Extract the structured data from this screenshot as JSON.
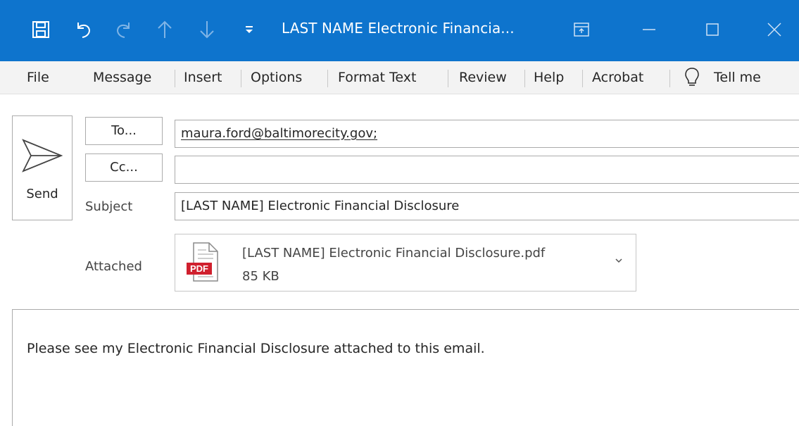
{
  "window": {
    "title": "LAST NAME Electronic Financia...",
    "icons": {
      "save": "save-icon",
      "undo": "undo-icon",
      "redo": "redo-icon",
      "up": "arrow-up-icon",
      "down": "arrow-down-icon",
      "customize": "customize-toolbar-icon",
      "ribbon_display": "ribbon-display-icon",
      "minimize": "minimize-icon",
      "maximize": "maximize-icon",
      "close": "close-icon"
    },
    "colors": {
      "titlebar": "#0e74cd",
      "menubar": "#f3f3f3"
    }
  },
  "menu": {
    "items": [
      "File",
      "Message",
      "Insert",
      "Options",
      "Format Text",
      "Review",
      "Help",
      "Acrobat"
    ],
    "tell_me": "Tell me"
  },
  "compose": {
    "send_label": "Send",
    "to_button": "To...",
    "cc_button": "Cc...",
    "to_value": "maura.ford@baltimorecity.gov;",
    "cc_value": "",
    "subject_label": "Subject",
    "subject_value": "[LAST NAME] Electronic Financial Disclosure",
    "attached_label": "Attached",
    "attachment": {
      "name": "[LAST NAME] Electronic Financial Disclosure.pdf",
      "size": "85 KB",
      "badge": "PDF",
      "badge_color": "#d0202e"
    }
  },
  "body": {
    "text": "Please see my Electronic Financial Disclosure attached to this email."
  }
}
